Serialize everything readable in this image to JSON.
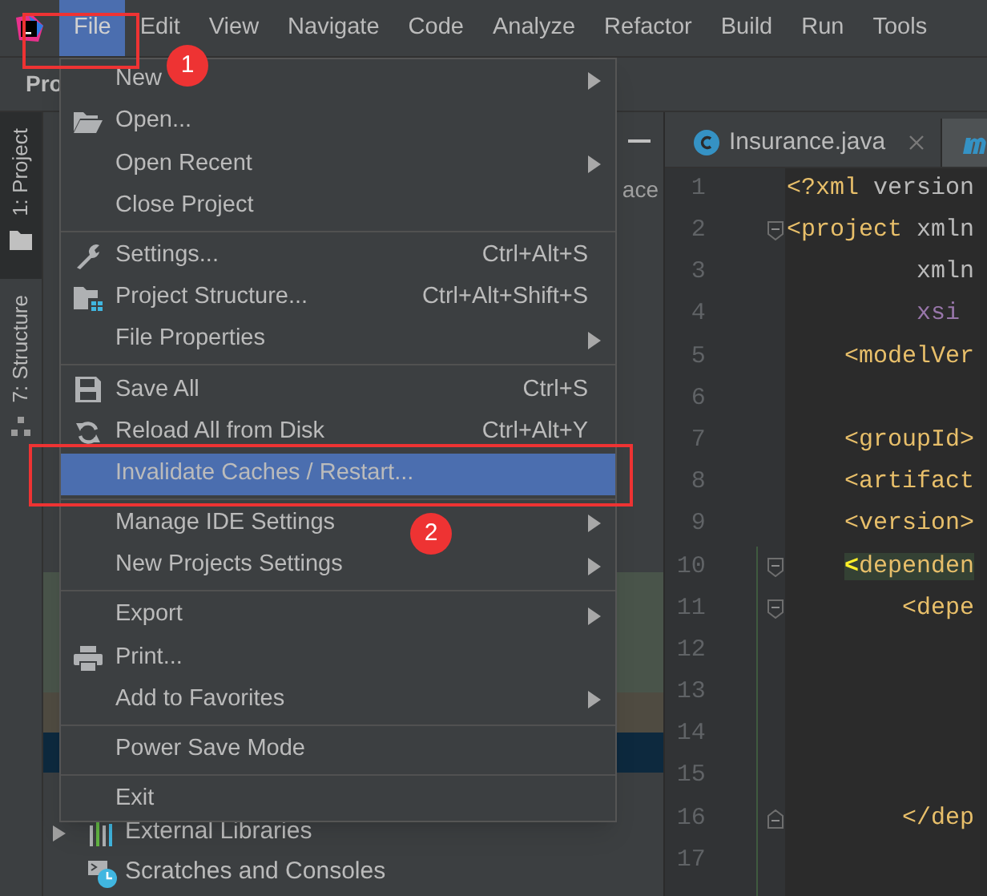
{
  "menu_bar": {
    "items": [
      {
        "label": "File",
        "selected": true
      },
      {
        "label": "Edit",
        "selected": false
      },
      {
        "label": "View",
        "selected": false
      },
      {
        "label": "Navigate",
        "selected": false
      },
      {
        "label": "Code",
        "selected": false
      },
      {
        "label": "Analyze",
        "selected": false
      },
      {
        "label": "Refactor",
        "selected": false
      },
      {
        "label": "Build",
        "selected": false
      },
      {
        "label": "Run",
        "selected": false
      },
      {
        "label": "Tools",
        "selected": false
      }
    ]
  },
  "project_panel": {
    "title": "Pro",
    "tool_tabs": [
      {
        "label": "1: Project",
        "selected": true
      },
      {
        "label": "7: Structure",
        "selected": false
      }
    ],
    "hidden_text": "ace",
    "tree": [
      {
        "label": "External Libraries",
        "expanded": false
      },
      {
        "label": "Scratches and Consoles"
      }
    ]
  },
  "editor": {
    "tabs": [
      {
        "label": "Insurance.java",
        "selected": false,
        "kind": "class"
      },
      {
        "selected": true,
        "kind": "maven"
      }
    ],
    "lines": [
      {
        "number": "1",
        "segments": [
          {
            "kind": "tag",
            "text": "<?xml"
          },
          {
            "kind": "attr",
            "text": " version"
          }
        ]
      },
      {
        "number": "2",
        "fold": true,
        "segments": [
          {
            "kind": "tag",
            "text": "<project"
          },
          {
            "kind": "attr",
            "text": " xmln"
          }
        ]
      },
      {
        "number": "3",
        "segments": [
          {
            "kind": "attr",
            "text": "         xmln"
          }
        ]
      },
      {
        "number": "4",
        "segments": [
          {
            "kind": "ns",
            "text": "         xsi"
          }
        ]
      },
      {
        "number": "5",
        "segments": [
          {
            "kind": "tag",
            "text": "    <modelVer"
          }
        ]
      },
      {
        "number": "6"
      },
      {
        "number": "7",
        "segments": [
          {
            "kind": "tag",
            "text": "    <groupId>"
          }
        ]
      },
      {
        "number": "8",
        "segments": [
          {
            "kind": "tag",
            "text": "    <artifact"
          }
        ]
      },
      {
        "number": "9",
        "segments": [
          {
            "kind": "tag",
            "text": "    <version>"
          }
        ]
      },
      {
        "number": "10",
        "fold": true,
        "segments": [
          {
            "kind": "match",
            "text": "    <",
            "highlighted": true
          },
          {
            "kind": "tag",
            "text": "dependen",
            "highlighted": true
          }
        ]
      },
      {
        "number": "11",
        "fold": true,
        "segments": [
          {
            "kind": "tag",
            "text": "        <depe"
          }
        ]
      },
      {
        "number": "12"
      },
      {
        "number": "13"
      },
      {
        "number": "14"
      },
      {
        "number": "15"
      },
      {
        "number": "16",
        "fold_end": true,
        "segments": [
          {
            "kind": "tag",
            "text": "        </dep"
          }
        ]
      },
      {
        "number": "17"
      }
    ]
  },
  "file_menu": {
    "groups": [
      [
        {
          "label": "New",
          "submenu": true,
          "selected": false
        },
        {
          "label": "Open...",
          "submenu": false,
          "selected": false
        },
        {
          "label": "Open Recent",
          "submenu": true,
          "selected": false
        },
        {
          "label": "Close Project",
          "submenu": false,
          "selected": false
        }
      ],
      [
        {
          "label": "Settings...",
          "shortcut": "Ctrl+Alt+S",
          "submenu": false,
          "selected": false
        },
        {
          "label": "Project Structure...",
          "shortcut": "Ctrl+Alt+Shift+S",
          "submenu": false,
          "selected": false
        },
        {
          "label": "File Properties",
          "submenu": true,
          "selected": false
        }
      ],
      [
        {
          "label": "Save All",
          "shortcut": "Ctrl+S",
          "submenu": false,
          "selected": false
        },
        {
          "label": "Reload All from Disk",
          "shortcut": "Ctrl+Alt+Y",
          "submenu": false,
          "selected": false
        },
        {
          "label": "Invalidate Caches / Restart...",
          "submenu": false,
          "selected": true
        }
      ],
      [
        {
          "label": "Manage IDE Settings",
          "submenu": true,
          "selected": false
        },
        {
          "label": "New Projects Settings",
          "submenu": true,
          "selected": false
        }
      ],
      [
        {
          "label": "Export",
          "submenu": true,
          "selected": false
        },
        {
          "label": "Print...",
          "submenu": false,
          "selected": false
        },
        {
          "label": "Add to Favorites",
          "submenu": true,
          "selected": false
        }
      ],
      [
        {
          "label": "Power Save Mode",
          "submenu": false,
          "selected": false
        }
      ],
      [
        {
          "label": "Exit",
          "submenu": false,
          "selected": false
        }
      ]
    ]
  },
  "callouts": [
    {
      "number": "1"
    },
    {
      "number": "2"
    }
  ]
}
